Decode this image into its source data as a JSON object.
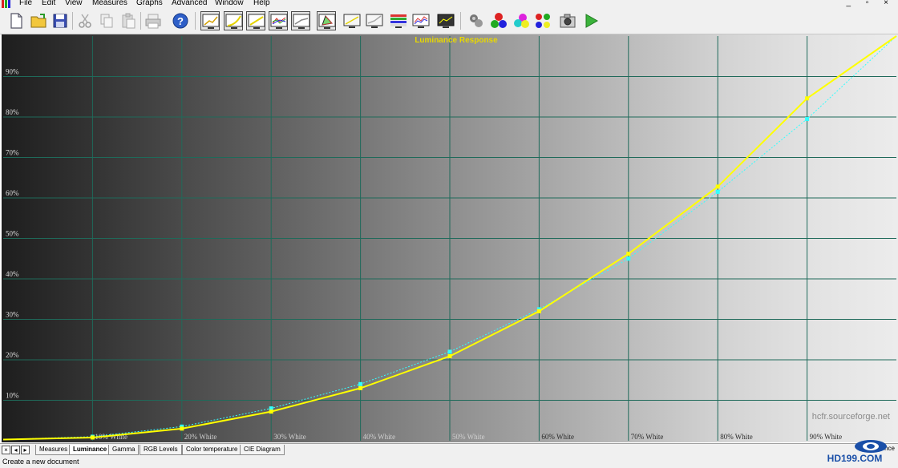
{
  "menu": [
    "File",
    "Edit",
    "View",
    "Measures",
    "Graphs",
    "Advanced",
    "Window",
    "Help"
  ],
  "window_controls": "_ ▫ ×",
  "toolbar_icons": [
    "new-document-icon",
    "open-folder-icon",
    "save-icon",
    "cut-icon",
    "copy-icon",
    "paste-icon",
    "print-icon",
    "help-icon",
    "graph-view-icon",
    "luminance-graph-icon",
    "gamma-graph-icon",
    "rgb-levels-graph-icon",
    "color-temperature-graph-icon",
    "cie-diagram-icon",
    "monitor-icon",
    "monitor-alt-icon",
    "gradient-display-icon",
    "measure-chart-icon",
    "screen-icon",
    "sensor-icon",
    "rgb-balls-icon",
    "color-balls-icon",
    "palette-icon",
    "camera-icon",
    "play-icon"
  ],
  "chart_data": {
    "type": "line",
    "title": "Luminance Response",
    "y_tick_labels": [
      "10%",
      "20%",
      "30%",
      "40%",
      "50%",
      "60%",
      "70%",
      "80%",
      "90%"
    ],
    "x_tick_labels": [
      "10% White",
      "20% White",
      "30% White",
      "40% White",
      "50% White",
      "60% White",
      "70% White",
      "80% White",
      "90% White"
    ],
    "x": [
      0,
      10,
      20,
      30,
      40,
      50,
      60,
      70,
      80,
      90,
      100
    ],
    "ylim": [
      0,
      100
    ],
    "xlim": [
      0,
      100
    ],
    "series": [
      {
        "values": [
          0.3,
          0.8,
          3.0,
          7.2,
          13.0,
          20.9,
          32.0,
          46.2,
          62.8,
          84.6,
          100
        ],
        "color": "#ffff00"
      },
      {
        "values": [
          0.3,
          1.0,
          3.5,
          8.0,
          14.0,
          22.0,
          32.5,
          45.0,
          61.5,
          79.5,
          100
        ],
        "color": "#33ffff"
      }
    ],
    "grid": true,
    "background": "grayscale gradient",
    "watermark": "hcfr.sourceforge.net"
  },
  "tabs": [
    "Measures",
    "Luminance",
    "Gamma",
    "RGB Levels",
    "Color temperature",
    "CIE Diagram"
  ],
  "active_tab": "Luminance",
  "tab_nav": [
    "×",
    "◂",
    "▸"
  ],
  "tab_right_text": "reference",
  "status_text": "Create a new document",
  "logo_text": "HD199.COM"
}
